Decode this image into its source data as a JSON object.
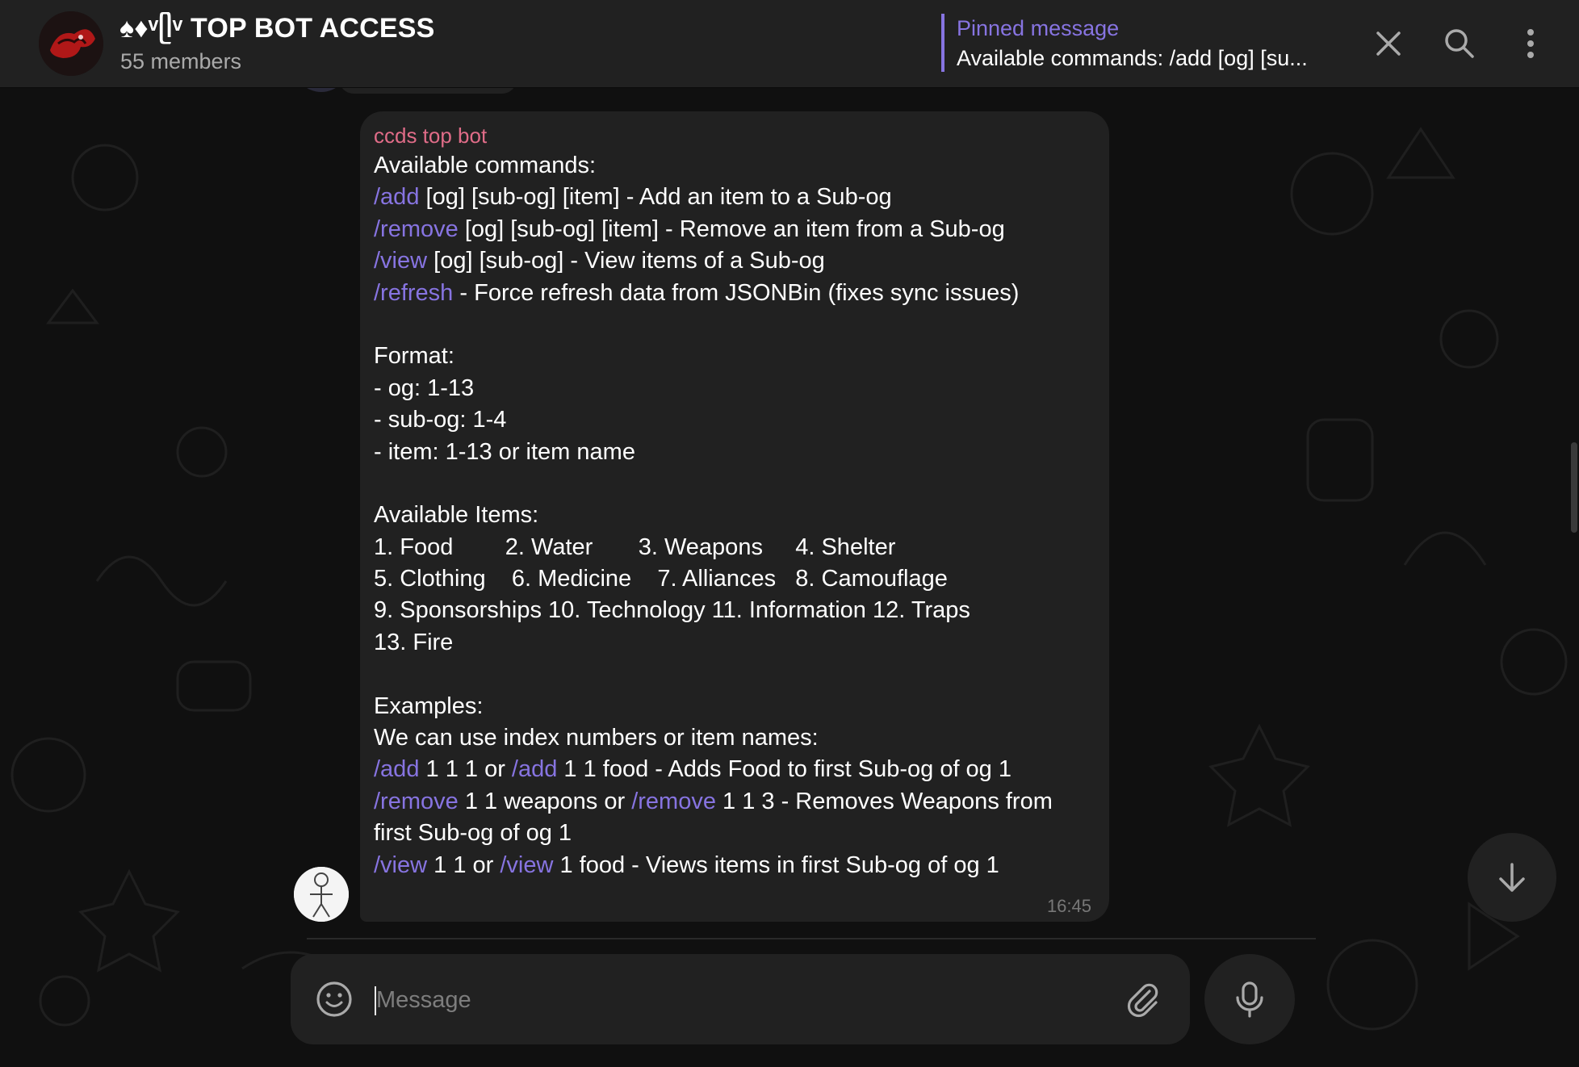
{
  "header": {
    "title": "♠♦ᵛᥫᵛ TOP BOT ACCESS",
    "members": "55 members",
    "pinned_label": "Pinned message",
    "pinned_text": "Available commands: /add [og] [su..."
  },
  "message": {
    "sender": "ccds top bot",
    "time": "16:45",
    "lines": [
      [
        {
          "t": "Available commands:"
        }
      ],
      [
        {
          "t": "/add",
          "cmd": true
        },
        {
          "t": " [og] [sub-og] [item] - Add an item to a Sub-og"
        }
      ],
      [
        {
          "t": "/remove",
          "cmd": true
        },
        {
          "t": " [og] [sub-og] [item] - Remove an item from a Sub-og"
        }
      ],
      [
        {
          "t": "/view",
          "cmd": true
        },
        {
          "t": " [og] [sub-og] - View items of a Sub-og"
        }
      ],
      [
        {
          "t": "/refresh",
          "cmd": true
        },
        {
          "t": " - Force refresh data from JSONBin (fixes sync issues)"
        }
      ],
      [
        {
          "t": ""
        }
      ],
      [
        {
          "t": "Format:"
        }
      ],
      [
        {
          "t": "- og: 1-13"
        }
      ],
      [
        {
          "t": "- sub-og: 1-4"
        }
      ],
      [
        {
          "t": "- item: 1-13 or item name"
        }
      ],
      [
        {
          "t": ""
        }
      ],
      [
        {
          "t": "Available Items:"
        }
      ],
      [
        {
          "t": "1. Food        2. Water       3. Weapons     4. Shelter"
        }
      ],
      [
        {
          "t": "5. Clothing    6. Medicine    7. Alliances   8. Camouflage"
        }
      ],
      [
        {
          "t": "9. Sponsorships 10. Technology 11. Information 12. Traps"
        }
      ],
      [
        {
          "t": "13. Fire"
        }
      ],
      [
        {
          "t": ""
        }
      ],
      [
        {
          "t": "Examples:"
        }
      ],
      [
        {
          "t": "We can use index numbers or item names:"
        }
      ],
      [
        {
          "t": "/add",
          "cmd": true
        },
        {
          "t": " 1 1 1 or "
        },
        {
          "t": "/add",
          "cmd": true
        },
        {
          "t": " 1 1 food - Adds Food to first Sub-og of og 1"
        }
      ],
      [
        {
          "t": "/remove",
          "cmd": true
        },
        {
          "t": " 1 1 weapons or "
        },
        {
          "t": "/remove",
          "cmd": true
        },
        {
          "t": " 1 1 3 - Removes Weapons from"
        }
      ],
      [
        {
          "t": "first Sub-og of og 1"
        }
      ],
      [
        {
          "t": "/view",
          "cmd": true
        },
        {
          "t": " 1 1 or "
        },
        {
          "t": "/view",
          "cmd": true
        },
        {
          "t": " 1 food - Views items in first Sub-og of og 1"
        }
      ]
    ]
  },
  "composer": {
    "placeholder": "Message"
  },
  "icons": {
    "close": "close-icon",
    "search": "search-icon",
    "more": "more-vertical-icon",
    "emoji": "emoji-icon",
    "attach": "paperclip-icon",
    "mic": "microphone-icon",
    "scroll": "arrow-down-icon"
  },
  "colors": {
    "accent": "#8774e1",
    "sender": "#e06c88",
    "bubble": "#212121",
    "background": "#101010"
  }
}
